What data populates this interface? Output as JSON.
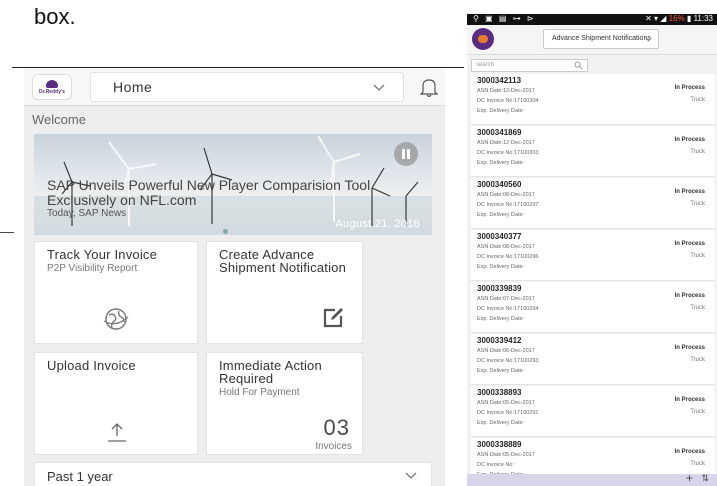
{
  "document": {
    "fragment_text": "box."
  },
  "left_app": {
    "logo_text": "Dr.Reddy's",
    "home_selector": {
      "label": "Home"
    },
    "welcome": "Welcome",
    "carousel": {
      "title": "SAP Unveils Powerful New Player Comparision Tool Exclusively on NFL.com",
      "source": "Today, SAP News",
      "date": "August 21, 2016"
    },
    "tiles": [
      {
        "title": "Track Your Invoice",
        "subtitle": "P2P Visibility Report",
        "icon": "globe-icon"
      },
      {
        "title": "Create Advance Shipment Notification",
        "subtitle": "",
        "icon": "edit-icon"
      },
      {
        "title": "Upload Invoice",
        "subtitle": "",
        "icon": "upload-icon"
      },
      {
        "title": "Immediate Action Required",
        "subtitle": "Hold For Payment",
        "count": "03",
        "unit": "Invoices"
      }
    ],
    "period_selector": {
      "label": "Past 1 year"
    }
  },
  "right_app": {
    "status_bar": {
      "battery": "16%",
      "time": "11:33"
    },
    "selector": {
      "label": "Advance Shipment Notifications"
    },
    "search": {
      "placeholder": "search"
    },
    "labels": {
      "asn_date": "ASN Date:",
      "dc_invoice": "DC Invoice No:",
      "delivery": "Exp. Delivery Date:"
    },
    "asn_list": [
      {
        "id": "3000342113",
        "asn_date": "12-Dec-2017",
        "invoice": "17100304",
        "status": "In Process",
        "mode": "Truck"
      },
      {
        "id": "3000341869",
        "asn_date": "12-Dec-2017",
        "invoice": "17100303",
        "status": "In Process",
        "mode": "Truck"
      },
      {
        "id": "3000340560",
        "asn_date": "08-Dec-2017",
        "invoice": "17100297",
        "status": "In Process",
        "mode": "Truck"
      },
      {
        "id": "3000340377",
        "asn_date": "08-Dec-2017",
        "invoice": "17100296",
        "status": "In Process",
        "mode": "Truck"
      },
      {
        "id": "3000339839",
        "asn_date": "07-Dec-2017",
        "invoice": "17100294",
        "status": "In Process",
        "mode": "Truck"
      },
      {
        "id": "3000339412",
        "asn_date": "06-Dec-2017",
        "invoice": "17100293",
        "status": "In Process",
        "mode": "Truck"
      },
      {
        "id": "3000338893",
        "asn_date": "05-Dec-2017",
        "invoice": "17100291",
        "status": "In Process",
        "mode": "Truck"
      },
      {
        "id": "3000338889",
        "asn_date": "05-Dec-2017",
        "invoice": "",
        "status": "In Process",
        "mode": "Truck"
      }
    ],
    "bottom_bar": {
      "add_glyph": "+",
      "sort_glyph": "⇅"
    }
  },
  "colors": {
    "brand_purple": "#5a2d82",
    "brand_orange": "#e77b2c",
    "battery_low": "#ff5a3a"
  }
}
